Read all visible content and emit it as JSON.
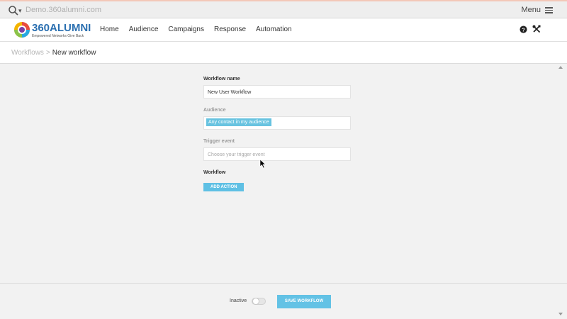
{
  "topbar": {
    "domain": "Demo.360alumni.com",
    "menu_label": "Menu"
  },
  "logo": {
    "brand": "360ALUMNI",
    "tagline": "Empowered Networks Give Back"
  },
  "nav": {
    "items": [
      "Home",
      "Audience",
      "Campaigns",
      "Response",
      "Automation"
    ]
  },
  "breadcrumb": {
    "parent": "Workflows",
    "separator": ">",
    "current": "New workflow"
  },
  "form": {
    "workflow_name_label": "Workflow name",
    "workflow_name_value": "New User Workflow",
    "audience_label": "Audience",
    "audience_tag": "Any contact in my audience",
    "trigger_label": "Trigger event",
    "trigger_placeholder": "Choose your trigger event",
    "workflow_label": "Workflow",
    "add_action_label": "ADD ACTION"
  },
  "footer": {
    "status_label": "Inactive",
    "save_label": "SAVE WORKFLOW"
  },
  "colors": {
    "accent": "#5fc0e4",
    "tag": "#68c3e0"
  }
}
